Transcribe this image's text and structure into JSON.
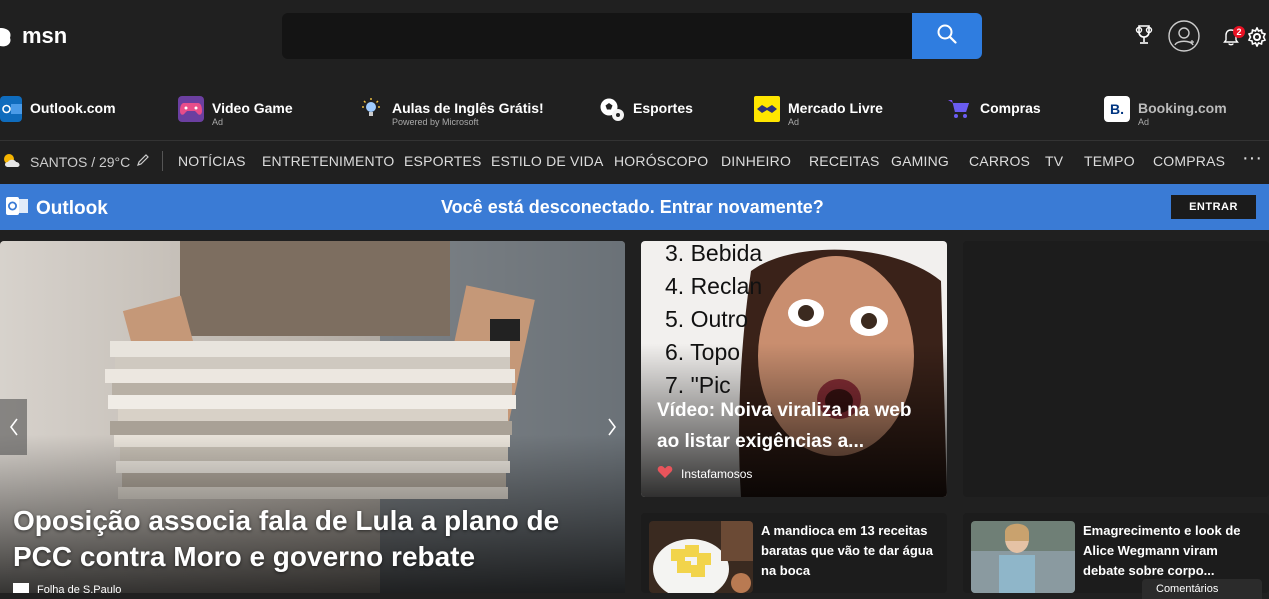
{
  "header": {
    "logo_text": "msn",
    "search_placeholder": "",
    "notifications_count": "2"
  },
  "quicklinks": [
    {
      "label": "Outlook.com",
      "sub": "",
      "icon": "outlook-icon"
    },
    {
      "label": "Video Game",
      "sub": "Ad",
      "icon": "gamepad-icon"
    },
    {
      "label": "Aulas de Inglês Grátis!",
      "sub": "Powered by Microsoft",
      "icon": "lightbulb-icon"
    },
    {
      "label": "Esportes",
      "sub": "",
      "icon": "soccer-ball-icon"
    },
    {
      "label": "Mercado Livre",
      "sub": "Ad",
      "icon": "handshake-icon"
    },
    {
      "label": "Compras",
      "sub": "",
      "icon": "shopping-cart-icon"
    },
    {
      "label": "Booking.com",
      "sub": "Ad",
      "icon": "booking-icon"
    }
  ],
  "weather": {
    "location_temp": "SANTOS / 29°C"
  },
  "nav": [
    "NOTÍCIAS",
    "ENTRETENIMENTO",
    "ESPORTES",
    "ESTILO DE VIDA",
    "HORÓSCOPO",
    "DINHEIRO",
    "RECEITAS",
    "GAMING",
    "CARROS",
    "TV",
    "TEMPO",
    "COMPRAS"
  ],
  "nav_more": "···",
  "outlook_bar": {
    "name": "Outlook",
    "message": "Você está desconectado. Entrar novamente?",
    "button": "ENTRAR"
  },
  "hero": {
    "title": "Oposição associa fala de Lula a plano de PCC contra Moro e governo rebate",
    "source": "Folha de S.Paulo"
  },
  "card2": {
    "title": "Vídeo: Noiva viraliza na web ao listar exigências a...",
    "source": "Instafamosos",
    "list_lines": [
      "3. Bebida",
      "4. Reclan",
      "5. Outro",
      "6. Topo",
      "7. \"Pic"
    ]
  },
  "small_cards": [
    {
      "title": "A mandioca em 13 receitas baratas que vão te dar água na boca"
    },
    {
      "title": "Emagrecimento e look de Alice Wegmann viram debate sobre corpo..."
    }
  ],
  "comments_label": "Comentários",
  "colors": {
    "bg": "#202020",
    "accent": "#2f7de0",
    "outlook_bar": "#3a7bd5"
  }
}
